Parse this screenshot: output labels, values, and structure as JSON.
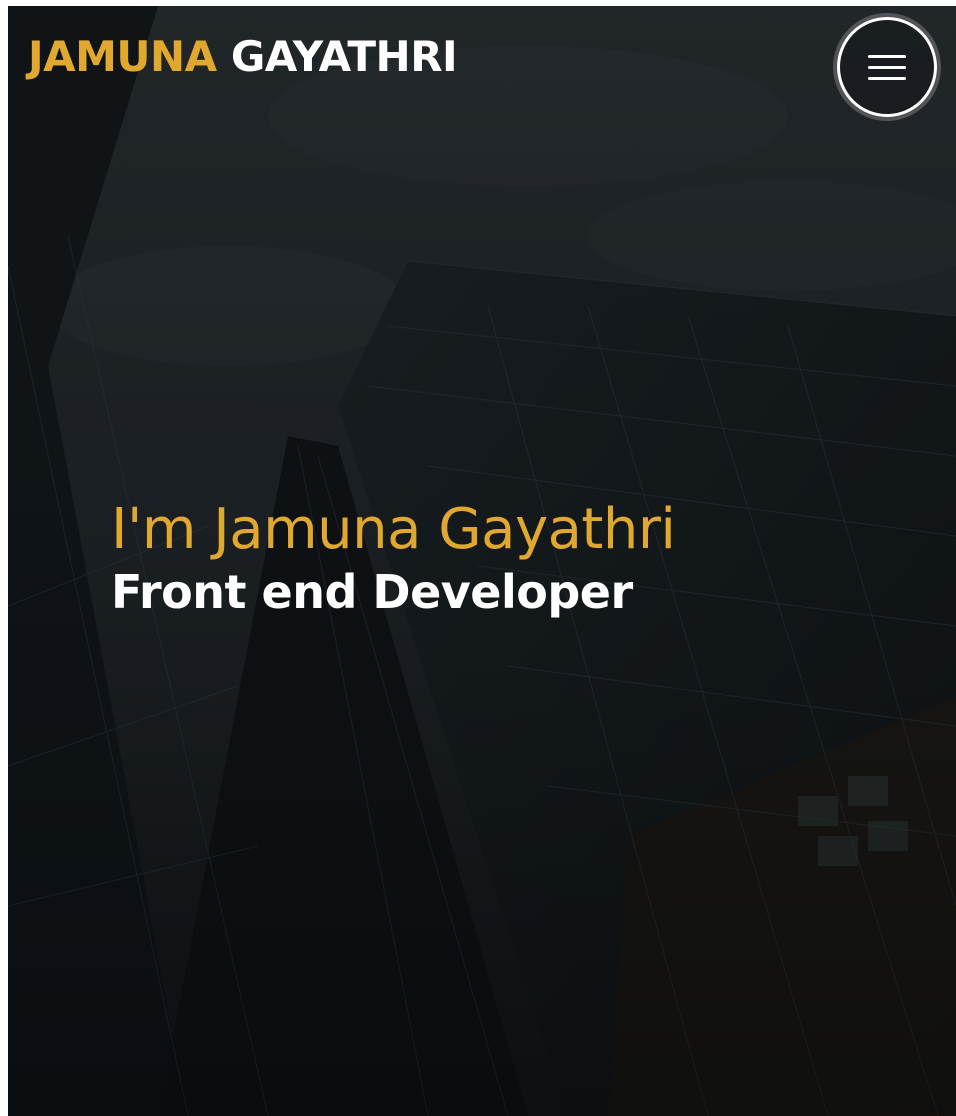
{
  "colors": {
    "accent": "#e0a82e",
    "text_light": "#ffffff",
    "background_dark": "#15191c"
  },
  "header": {
    "logo_first": "JAMUNA",
    "logo_last": "GAYATHRI",
    "menu_icon": "hamburger-menu-icon"
  },
  "hero": {
    "background_image": "building-skyscraper-photo",
    "name": "I'm Jamuna Gayathri",
    "role": "Front end Developer"
  }
}
